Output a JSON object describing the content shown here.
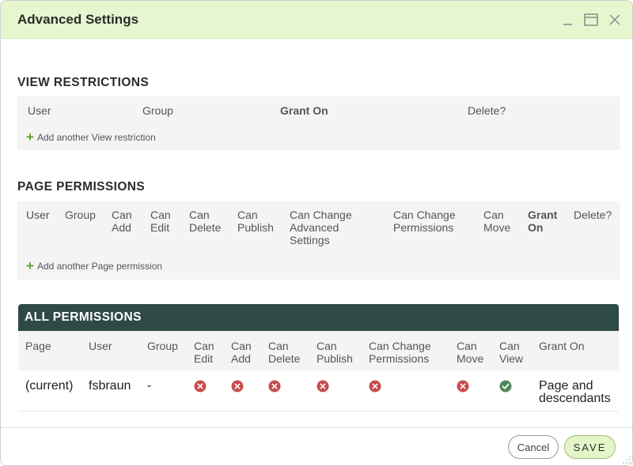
{
  "window": {
    "title": "Advanced Settings"
  },
  "view_restrictions": {
    "title": "VIEW RESTRICTIONS",
    "columns": [
      "User",
      "Group",
      "Grant On",
      "Delete?"
    ],
    "add_link": "Add another View restriction"
  },
  "page_permissions": {
    "title": "PAGE PERMISSIONS",
    "columns": [
      "User",
      "Group",
      "Can\nAdd",
      "Can\nEdit",
      "Can\nDelete",
      "Can\nPublish",
      "Can Change\nAdvanced\nSettings",
      "Can Change\nPermissions",
      "Can\nMove",
      "Grant\nOn",
      "Delete?"
    ],
    "add_link": "Add another Page permission"
  },
  "all_permissions": {
    "title": "ALL PERMISSIONS",
    "columns": [
      "Page",
      "User",
      "Group",
      "Can\nEdit",
      "Can\nAdd",
      "Can\nDelete",
      "Can\nPublish",
      "Can Change\nPermissions",
      "Can\nMove",
      "Can\nView",
      "Grant On"
    ],
    "rows": [
      {
        "page": "(current)",
        "user": "fsbraun",
        "group": "-",
        "can_edit": false,
        "can_add": false,
        "can_delete": false,
        "can_publish": false,
        "can_change_permissions": false,
        "can_move": false,
        "can_view": true,
        "grant_on": "Page and\ndescendants"
      }
    ]
  },
  "footer": {
    "cancel_label": "Cancel",
    "save_label": "SAVE"
  },
  "colors": {
    "title_bar": "#e6f7cf",
    "section_bar": "#2e4a47",
    "deny": "#c84b4b",
    "allow": "#4e8a5a",
    "add_plus": "#5aa02c"
  },
  "icons": {
    "minimize": "minimize-icon",
    "maximize": "maximize-icon",
    "close": "close-icon",
    "deny": "x-circle-icon",
    "allow": "check-circle-icon",
    "add": "plus-icon",
    "resize": "resize-grip-icon"
  }
}
